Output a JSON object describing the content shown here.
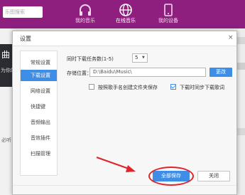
{
  "app": {
    "search_placeholder": "乐图搜索",
    "nav": {
      "music_label": "我的音乐",
      "online_label": "在线音乐",
      "device_label": "我的设备"
    },
    "left": {
      "banner_title": "曲",
      "banner_sub": "为你的",
      "text1": "",
      "text2": "必听"
    },
    "colors": {
      "header": "#8e1f7e",
      "accent": "#3e8ee7",
      "highlight": "#e0242b"
    }
  },
  "dialog": {
    "title": "设置",
    "close_glyph": "×",
    "menu": [
      "常规设置",
      "下载设置",
      "网络设置",
      "快捷键",
      "音频输出",
      "音效插件",
      "扫描管理"
    ],
    "active_menu": "下载设置",
    "concurrent_label": "同时下载任务数(1-5)",
    "concurrent_value": "5",
    "location_label": "存储位置：",
    "location_value": "D:\\Baidu\\Music\\",
    "change_label": "更改",
    "checkbox1_label": "按照歌手名创建文件夹保存",
    "checkbox1_checked": false,
    "checkbox2_label": "下载时同步下载歌词",
    "checkbox2_checked": true,
    "save_label": "全部保存",
    "close_label": "关闭"
  }
}
